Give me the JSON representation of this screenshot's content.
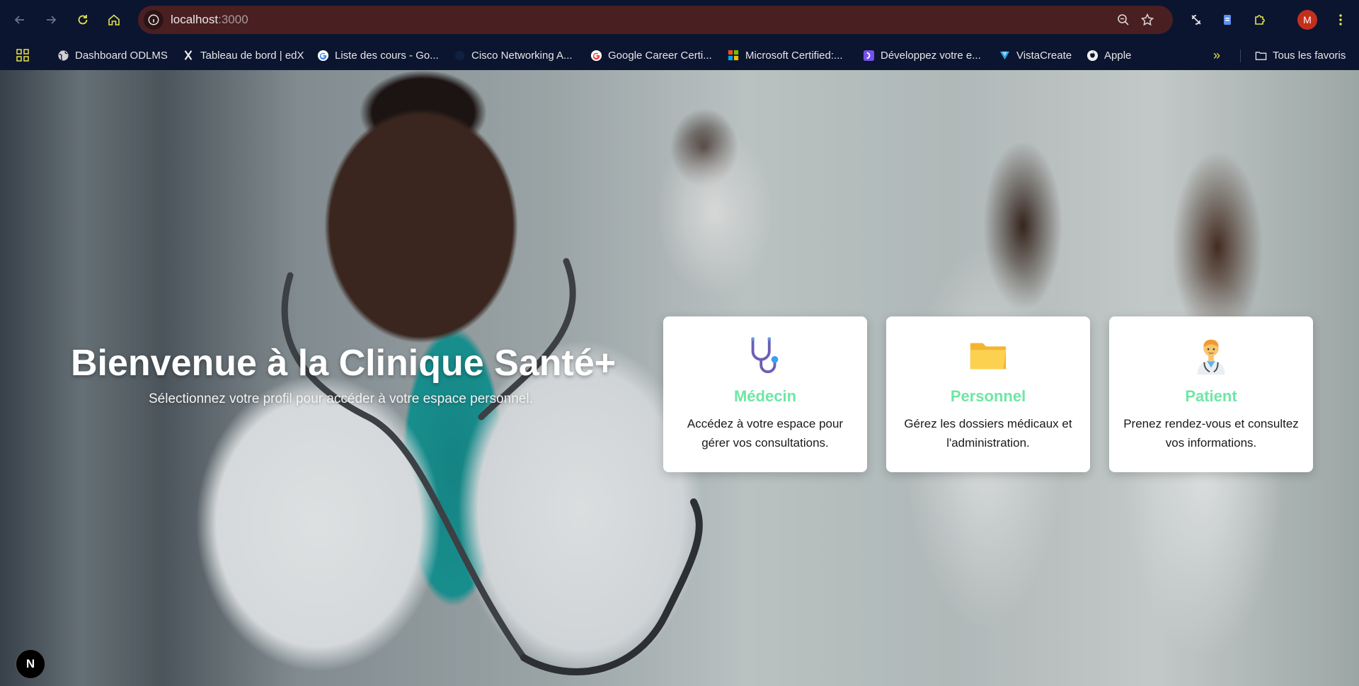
{
  "browser": {
    "url_host": "localhost",
    "url_port": ":3000",
    "profile_initial": "M",
    "overflow_label": "»",
    "bookmarks": [
      {
        "label": "Dashboard ODLMS",
        "icon": "globe-icon"
      },
      {
        "label": "Tableau de bord | edX",
        "icon": "edx-icon"
      },
      {
        "label": "Liste des cours - Go...",
        "icon": "google-icon"
      },
      {
        "label": "Cisco Networking A...",
        "icon": "cisco-icon"
      },
      {
        "label": "Google Career Certi...",
        "icon": "google-icon"
      },
      {
        "label": "Microsoft Certified:...",
        "icon": "microsoft-icon"
      },
      {
        "label": "Développez votre e...",
        "icon": "openclassrooms-icon"
      },
      {
        "label": "VistaCreate",
        "icon": "vistacreate-icon"
      },
      {
        "label": "Apple",
        "icon": "apple-icon"
      }
    ],
    "all_bookmarks_label": "Tous les favoris"
  },
  "hero": {
    "title": "Bienvenue à la Clinique Santé+",
    "subtitle": "Sélectionnez votre profil pour accéder à votre espace personnel."
  },
  "cards": [
    {
      "title": "Médecin",
      "desc": "Accédez à votre espace pour gérer vos consultations.",
      "icon": "stethoscope-icon"
    },
    {
      "title": "Personnel",
      "desc": "Gérez les dossiers médicaux et l'administration.",
      "icon": "folder-icon"
    },
    {
      "title": "Patient",
      "desc": "Prenez rendez-vous et consultez vos informations.",
      "icon": "health-worker-icon"
    }
  ],
  "dev_badge": "N",
  "colors": {
    "chrome_bg": "#0b1530",
    "omnibox_bg": "#4a1f22",
    "card_title": "#6ee7a4",
    "avatar_bg": "#c42f1c"
  }
}
